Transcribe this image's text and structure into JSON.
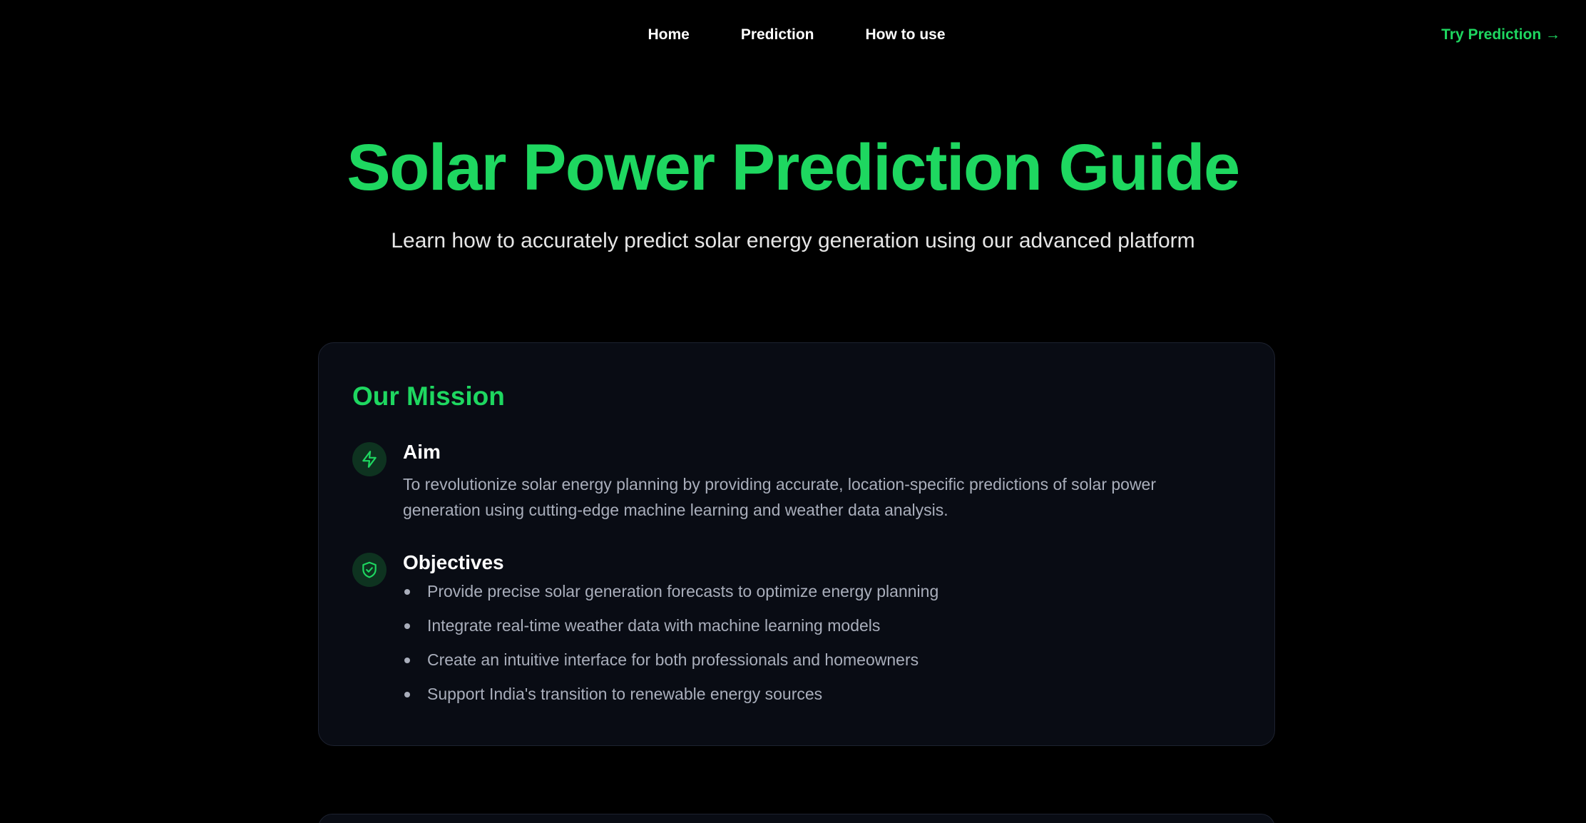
{
  "nav": {
    "links": [
      {
        "label": "Home"
      },
      {
        "label": "Prediction"
      },
      {
        "label": "How to use"
      }
    ],
    "cta_label": "Try Prediction →"
  },
  "hero": {
    "title": "Solar Power Prediction Guide",
    "subtitle": "Learn how to accurately predict solar energy generation using our advanced platform"
  },
  "mission": {
    "title": "Our Mission",
    "aim": {
      "icon": "lightning-icon",
      "heading": "Aim",
      "text": "To revolutionize solar energy planning by providing accurate, location-specific predictions of solar power generation using cutting-edge machine learning and weather data analysis."
    },
    "objectives": {
      "icon": "shield-check-icon",
      "heading": "Objectives",
      "items": [
        "Provide precise solar generation forecasts to optimize energy planning",
        "Integrate real-time weather data with machine learning models",
        "Create an intuitive interface for both professionals and homeowners",
        "Support India's transition to renewable energy sources"
      ]
    }
  },
  "colors": {
    "accent": "#1ed760",
    "background": "#000000",
    "card_background": "#090c14",
    "muted_text": "#a9aebb"
  }
}
